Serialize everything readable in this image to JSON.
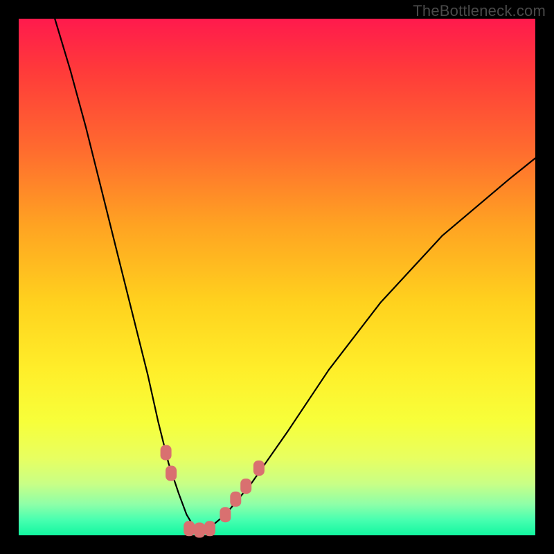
{
  "watermark": "TheBottleneck.com",
  "colors": {
    "background_frame": "#000000",
    "gradient_top": "#ff1a4d",
    "gradient_bottom": "#12f7a0",
    "curve_stroke": "#000000",
    "marker_fill": "#d97070"
  },
  "chart_data": {
    "type": "line",
    "title": "",
    "xlabel": "",
    "ylabel": "",
    "xlim": [
      0,
      100
    ],
    "ylim": [
      0,
      100
    ],
    "grid": false,
    "legend": false,
    "series": [
      {
        "name": "bottleneck-curve",
        "x": [
          7,
          10,
          13,
          16,
          19,
          22,
          25,
          27,
          29,
          31,
          32.5,
          34,
          35.5,
          37,
          40,
          45,
          52,
          60,
          70,
          82,
          95,
          100
        ],
        "y": [
          100,
          90,
          79,
          67,
          55,
          43,
          31,
          22,
          14,
          8,
          4,
          1.5,
          1,
          1.5,
          4,
          10,
          20,
          32,
          45,
          58,
          69,
          73
        ]
      }
    ],
    "markers": [
      {
        "name": "marker-left-1",
        "x": 28.5,
        "y": 16
      },
      {
        "name": "marker-left-2",
        "x": 29.5,
        "y": 12
      },
      {
        "name": "marker-bottom-1",
        "x": 33,
        "y": 1.3
      },
      {
        "name": "marker-bottom-2",
        "x": 35,
        "y": 1
      },
      {
        "name": "marker-bottom-3",
        "x": 37,
        "y": 1.3
      },
      {
        "name": "marker-right-1",
        "x": 40,
        "y": 4
      },
      {
        "name": "marker-right-2",
        "x": 42,
        "y": 7
      },
      {
        "name": "marker-right-3",
        "x": 44,
        "y": 9.5
      },
      {
        "name": "marker-right-4",
        "x": 46.5,
        "y": 13
      }
    ]
  }
}
